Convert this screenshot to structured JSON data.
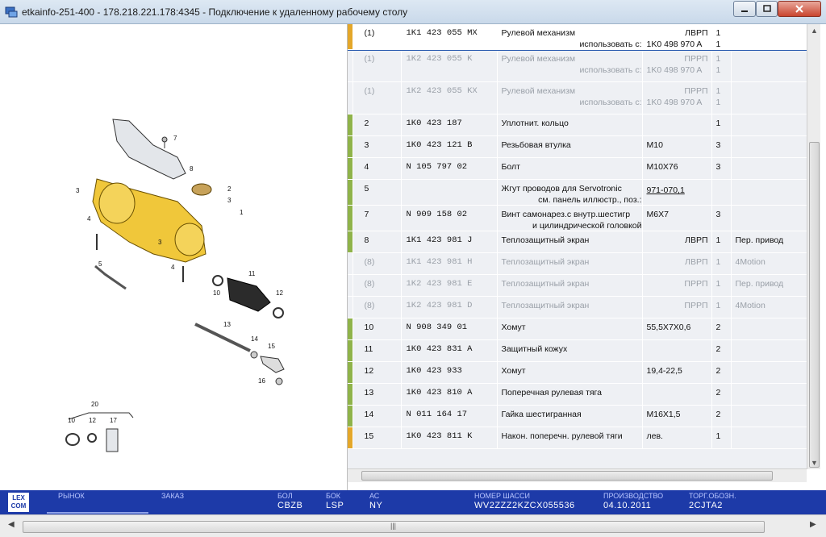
{
  "window": {
    "title": "etkainfo-251-400 - 178.218.221.178:4345 - Подключение к удаленному рабочему столу"
  },
  "diagram": {
    "callouts": [
      "7",
      "8",
      "2",
      "3",
      "1",
      "3",
      "4",
      "5",
      "3",
      "4",
      "10",
      "11",
      "12",
      "13",
      "14",
      "15",
      "16",
      "20",
      "10",
      "12",
      "17"
    ]
  },
  "parts": [
    {
      "pos": "(1)",
      "part": "1K1 423 055 MX",
      "desc": "Рулевой механизм",
      "desc2": "использовать с:",
      "note": "ЛВРП",
      "note2": "1K0 498 970 A",
      "qty": "1",
      "qty2": "1",
      "rem": "",
      "state": "selected",
      "bar": "#e4a72a"
    },
    {
      "pos": "(1)",
      "part": "1K2 423 055 K",
      "desc": "Рулевой механизм",
      "desc2": "использовать с:",
      "note": "ПРРП",
      "note2": "1K0 498 970 A",
      "qty": "1",
      "qty2": "1",
      "rem": "",
      "state": "dim",
      "bar": ""
    },
    {
      "pos": "(1)",
      "part": "1K2 423 055 KX",
      "desc": "Рулевой механизм",
      "desc2": "использовать с:",
      "note": "ПРРП",
      "note2": "1K0 498 970 A",
      "qty": "1",
      "qty2": "1",
      "rem": "",
      "state": "dim",
      "bar": ""
    },
    {
      "pos": "2",
      "part": "1K0 423 187",
      "desc": "Уплотнит. кольцо",
      "desc2": "",
      "note": "",
      "note2": "",
      "qty": "1",
      "qty2": "",
      "rem": "",
      "state": "normal",
      "bar": "#8fb34a"
    },
    {
      "pos": "3",
      "part": "1K0 423 121 B",
      "desc": "Резьбовая втулка",
      "desc2": "",
      "note": "M10",
      "note2": "",
      "qty": "3",
      "qty2": "",
      "rem": "",
      "state": "normal",
      "bar": "#8fb34a"
    },
    {
      "pos": "4",
      "part": "N 105 797 02",
      "desc": "Болт",
      "desc2": "",
      "note": "M10X76",
      "note2": "",
      "qty": "3",
      "qty2": "",
      "rem": "",
      "state": "normal",
      "bar": "#8fb34a"
    },
    {
      "pos": "5",
      "part": "",
      "desc": "Жгут проводов для Servotronic",
      "desc2": "см. панель иллюстр., поз.:",
      "note": "",
      "note2": "971-070,1",
      "qty": "",
      "qty2": "",
      "rem": "",
      "state": "normal",
      "bar": "#8fb34a"
    },
    {
      "pos": "7",
      "part": "N 909 158 02",
      "desc": "Винт самонарез.с внутр.шестигр",
      "desc2": "и цилиндрической головкой",
      "note": "M6X7",
      "note2": "",
      "qty": "3",
      "qty2": "",
      "rem": "",
      "state": "normal",
      "bar": "#8fb34a"
    },
    {
      "pos": "8",
      "part": "1K1 423 981 J",
      "desc": "Теплозащитный экран",
      "desc2": "",
      "note": "ЛВРП",
      "note2": "",
      "qty": "1",
      "qty2": "",
      "rem": "Пер. привод",
      "state": "normal",
      "bar": "#8fb34a"
    },
    {
      "pos": "(8)",
      "part": "1K1 423 981 H",
      "desc": "Теплозащитный экран",
      "desc2": "",
      "note": "ЛВРП",
      "note2": "",
      "qty": "1",
      "qty2": "",
      "rem": "4Motion",
      "state": "dim",
      "bar": ""
    },
    {
      "pos": "(8)",
      "part": "1K2 423 981 E",
      "desc": "Теплозащитный экран",
      "desc2": "",
      "note": "ПРРП",
      "note2": "",
      "qty": "1",
      "qty2": "",
      "rem": "Пер. привод",
      "state": "dim",
      "bar": ""
    },
    {
      "pos": "(8)",
      "part": "1K2 423 981 D",
      "desc": "Теплозащитный экран",
      "desc2": "",
      "note": "ПРРП",
      "note2": "",
      "qty": "1",
      "qty2": "",
      "rem": "4Motion",
      "state": "dim",
      "bar": ""
    },
    {
      "pos": "10",
      "part": "N 908 349 01",
      "desc": "Хомут",
      "desc2": "",
      "note": "55,5X7X0,6",
      "note2": "",
      "qty": "2",
      "qty2": "",
      "rem": "",
      "state": "normal",
      "bar": "#8fb34a"
    },
    {
      "pos": "11",
      "part": "1K0 423 831 A",
      "desc": "Защитный кожух",
      "desc2": "",
      "note": "",
      "note2": "",
      "qty": "2",
      "qty2": "",
      "rem": "",
      "state": "normal",
      "bar": "#8fb34a"
    },
    {
      "pos": "12",
      "part": "1K0 423 933",
      "desc": "Хомут",
      "desc2": "",
      "note": "19,4-22,5",
      "note2": "",
      "qty": "2",
      "qty2": "",
      "rem": "",
      "state": "normal",
      "bar": "#8fb34a"
    },
    {
      "pos": "13",
      "part": "1K0 423 810 A",
      "desc": "Поперечная рулевая тяга",
      "desc2": "",
      "note": "",
      "note2": "",
      "qty": "2",
      "qty2": "",
      "rem": "",
      "state": "normal",
      "bar": "#8fb34a"
    },
    {
      "pos": "14",
      "part": "N 011 164 17",
      "desc": "Гайка шестигранная",
      "desc2": "",
      "note": "M16X1,5",
      "note2": "",
      "qty": "2",
      "qty2": "",
      "rem": "",
      "state": "normal",
      "bar": "#8fb34a"
    },
    {
      "pos": "15",
      "part": "1K0 423 811 K",
      "desc": "Након. поперечн. рулевой тяги",
      "desc2": "",
      "note": "лев.",
      "note2": "",
      "qty": "1",
      "qty2": "",
      "rem": "",
      "state": "normal",
      "bar": "#e4a72a"
    }
  ],
  "status": {
    "logo": "LEX COM",
    "fields": [
      {
        "label": "РЫНОК",
        "value": ""
      },
      {
        "label": "ЗАКАЗ",
        "value": ""
      },
      {
        "label": "БОЛ",
        "value": "CBZB"
      },
      {
        "label": "БОК",
        "value": "LSP"
      },
      {
        "label": "АС",
        "value": "NY"
      },
      {
        "label": "НОМЕР ШАССИ",
        "value": "WV2ZZZ2KZCX055536"
      },
      {
        "label": "ПРОИЗВОДСТВО",
        "value": "04.10.2011"
      },
      {
        "label": "ТОРГ.ОБОЗН.",
        "value": "2CJTA2"
      }
    ]
  },
  "colors": {
    "status_bg": "#1d3aa8",
    "bar_green": "#8fb34a",
    "bar_orange": "#e4a72a",
    "part_yellow": "#f0c73a"
  }
}
